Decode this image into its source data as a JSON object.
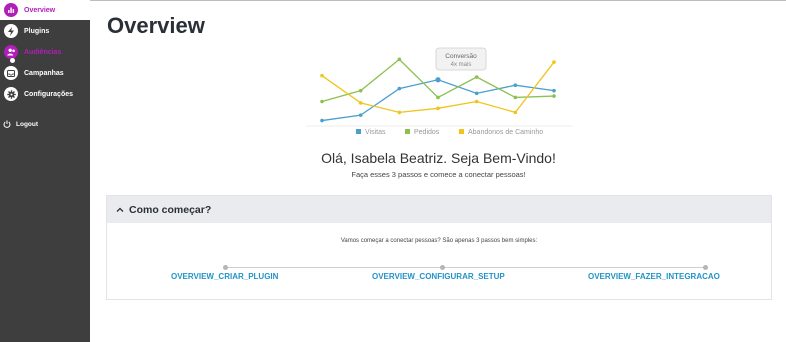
{
  "sidebar": {
    "items": [
      {
        "label": "Overview"
      },
      {
        "label": "Plugins"
      },
      {
        "label": "Audiências"
      },
      {
        "label": "Campanhas"
      },
      {
        "label": "Configurações"
      }
    ],
    "logout": "Logout"
  },
  "page": {
    "title": "Overview",
    "greeting": "Olá, Isabela Beatriz. Seja Bem-Vindo!",
    "subtitle": "Faça esses 3 passos e comece a conectar pessoas!"
  },
  "chart_data": {
    "type": "line",
    "tooltip": {
      "title": "Conversão",
      "value": "4x mais"
    },
    "x": [
      1,
      2,
      3,
      4,
      5,
      6,
      7
    ],
    "series": [
      {
        "name": "Visitas",
        "color": "#4a9fce",
        "values": [
          8,
          16,
          55,
          68,
          48,
          60,
          52
        ]
      },
      {
        "name": "Pedidos",
        "color": "#8cc152",
        "values": [
          36,
          52,
          98,
          42,
          72,
          42,
          44
        ]
      },
      {
        "name": "Abandonos de Caminho",
        "color": "#f0c419",
        "values": [
          74,
          34,
          20,
          26,
          36,
          20,
          94
        ]
      }
    ],
    "legend_position": "bottom",
    "grid": false
  },
  "panel": {
    "title": "Como começar?",
    "text": "Vamos começar a conectar pessoas? São apenas 3 passos bem simples:",
    "steps": [
      "OVERVIEW_CRIAR_PLUGIN",
      "OVERVIEW_CONFIGURAR_SETUP",
      "OVERVIEW_FAZER_INTEGRACAO"
    ]
  }
}
